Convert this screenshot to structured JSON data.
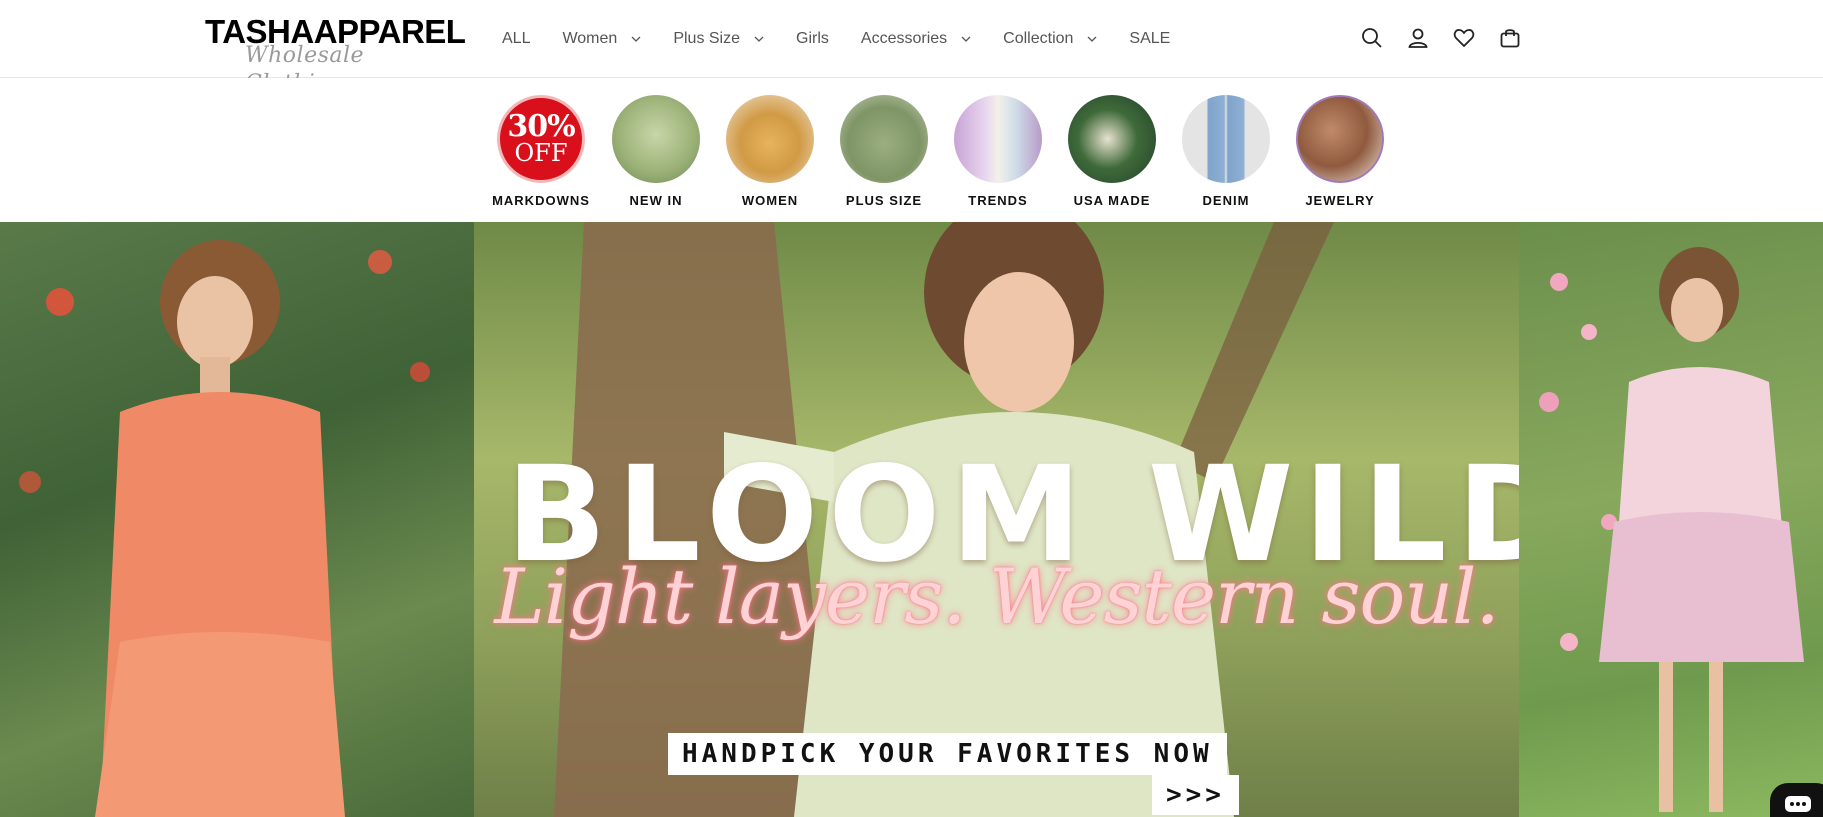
{
  "brand": {
    "logo_main": "TASHAAPPAREL",
    "logo_sub": "Wholesale Clothing"
  },
  "nav": {
    "items": [
      {
        "label": "ALL",
        "has_dropdown": false
      },
      {
        "label": "Women",
        "has_dropdown": true
      },
      {
        "label": "Plus Size",
        "has_dropdown": true
      },
      {
        "label": "Girls",
        "has_dropdown": false
      },
      {
        "label": "Accessories",
        "has_dropdown": true
      },
      {
        "label": "Collection",
        "has_dropdown": true
      },
      {
        "label": "SALE",
        "has_dropdown": false
      }
    ]
  },
  "header_icons": [
    "search-icon",
    "account-icon",
    "wishlist-heart-icon",
    "cart-icon"
  ],
  "categories": {
    "markdown_badge_big": "30%",
    "markdown_badge_small": "OFF",
    "items": [
      {
        "label": "MARKDOWNS"
      },
      {
        "label": "NEW IN"
      },
      {
        "label": "WOMEN"
      },
      {
        "label": "PLUS SIZE"
      },
      {
        "label": "TRENDS"
      },
      {
        "label": "USA MADE"
      },
      {
        "label": "DENIM"
      },
      {
        "label": "JEWELRY"
      }
    ]
  },
  "hero": {
    "title": "BLOOM WILDLY",
    "script": "Light layers. Western soul.",
    "cta_line1": "HANDPICK YOUR FAVORITES NOW",
    "cta_line2": ">>>"
  },
  "colors": {
    "accent_red": "#d9101c",
    "script_pink": "#ffd3d6",
    "nav_text": "#555555"
  }
}
